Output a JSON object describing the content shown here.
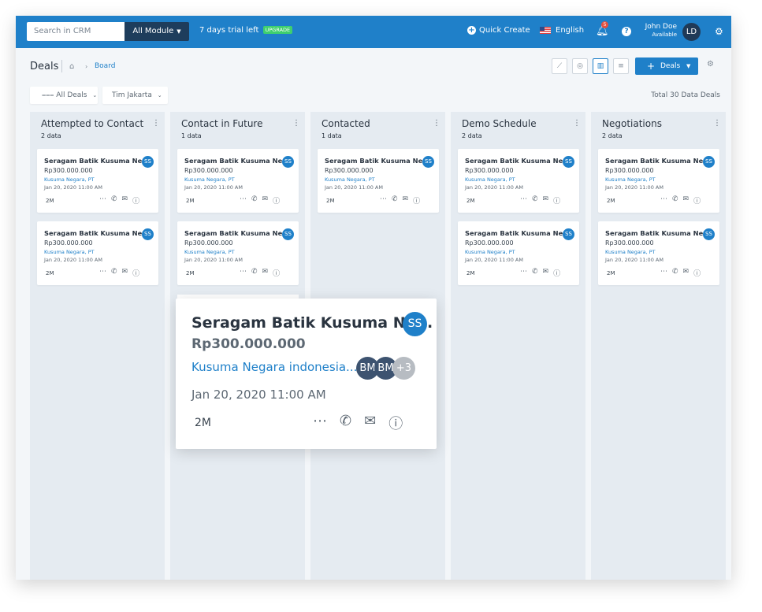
{
  "topbar": {
    "search_placeholder": "Search in CRM",
    "module_label": "All Module",
    "trial_text": "7 days trial left",
    "upgrade_label": "UPGRADE",
    "quick_create": "Quick Create",
    "language": "English",
    "notifications": "5",
    "help": "?",
    "user_name": "John Doe",
    "user_status": "Available",
    "user_initials": "LD"
  },
  "header": {
    "title": "Deals",
    "breadcrumb_current": "Board",
    "deals_button": "Deals"
  },
  "filters": {
    "all_deals": "All Deals",
    "team": "Tim Jakarta",
    "total": "Total 30 Data Deals"
  },
  "columns": [
    {
      "title": "Attempted to Contact",
      "count": "2 data"
    },
    {
      "title": "Contact in Future",
      "count": "1 data"
    },
    {
      "title": "Contacted",
      "count": "1 data"
    },
    {
      "title": "Demo Schedule",
      "count": "2 data"
    },
    {
      "title": "Negotiations",
      "count": "2 data"
    }
  ],
  "card": {
    "title": "Seragam Batik Kusuma Ne...",
    "amount": "Rp300.000.000",
    "company": "Kusuma Negara, PT",
    "date": "Jan 20, 2020 11:00 AM",
    "age": "2M",
    "owner": "SS"
  },
  "dragged_card": {
    "title": "Seragam Batik Kusuma Ne...",
    "amount": "Rp300.000.000",
    "company": "Kusuma Negara indonesia...",
    "date": "Jan 20, 2020 11:00 AM",
    "age": "2M",
    "owner": "SS",
    "members": [
      "BM",
      "BM"
    ],
    "more_members": "+3"
  },
  "colors": {
    "brand": "#1f80c9",
    "navy": "#1e3d5c",
    "column_bg": "#e5ebf1",
    "upgrade": "#3ecf6e"
  }
}
